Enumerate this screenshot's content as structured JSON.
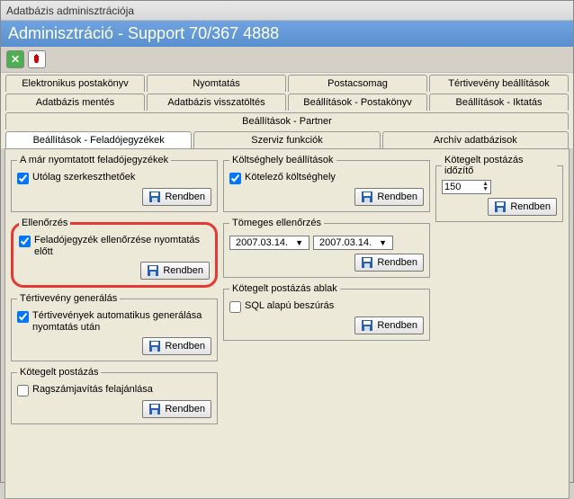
{
  "window": {
    "title": "Adatbázis adminisztrációja"
  },
  "header": {
    "title": "Adminisztráció - Support 70/367 4888"
  },
  "tabs_row1": [
    "Elektronikus postakönyv",
    "Nyomtatás",
    "Postacsomag",
    "Tértivevény beállítások"
  ],
  "tabs_row2": [
    "Adatbázis mentés",
    "Adatbázis visszatöltés",
    "Beállítások - Postakönyv",
    "Beállítások - Iktatás",
    "Beállítások - Partner"
  ],
  "tabs_row3": [
    "Beállítások - Feladójegyzékek",
    "Szerviz funkciók",
    "Archív adatbázisok"
  ],
  "groups": {
    "nyomtatott": {
      "legend": "A már nyomtatott feladójegyzékek",
      "chk": "Utólag szerkeszthetőek",
      "btn": "Rendben"
    },
    "ellenorzes": {
      "legend": "Ellenőrzés",
      "chk": "Feladójegyzék ellenőrzése nyomtatás előtt",
      "btn": "Rendben"
    },
    "tertivveveny": {
      "legend": "Tértivevény generálás",
      "chk": "Tértivevények automatikus generálása nyomtatás után",
      "btn": "Rendben"
    },
    "kotegelt_post": {
      "legend": "Kötegelt postázás",
      "chk": "Ragszámjavítás felajánlása",
      "btn": "Rendben"
    },
    "koltseghely": {
      "legend": "Költséghely beállítások",
      "chk": "Kötelező költséghely",
      "btn": "Rendben"
    },
    "tomeges": {
      "legend": "Tömeges ellenőrzés",
      "date1": "2007.03.14.",
      "date2": "2007.03.14.",
      "btn": "Rendben"
    },
    "kotegelt_ablak": {
      "legend": "Kötegelt postázás ablak",
      "chk": "SQL alapú beszúrás",
      "btn": "Rendben"
    },
    "idozito": {
      "legend": "Kötegelt postázás időzítő",
      "value": "150",
      "btn": "Rendben"
    }
  }
}
